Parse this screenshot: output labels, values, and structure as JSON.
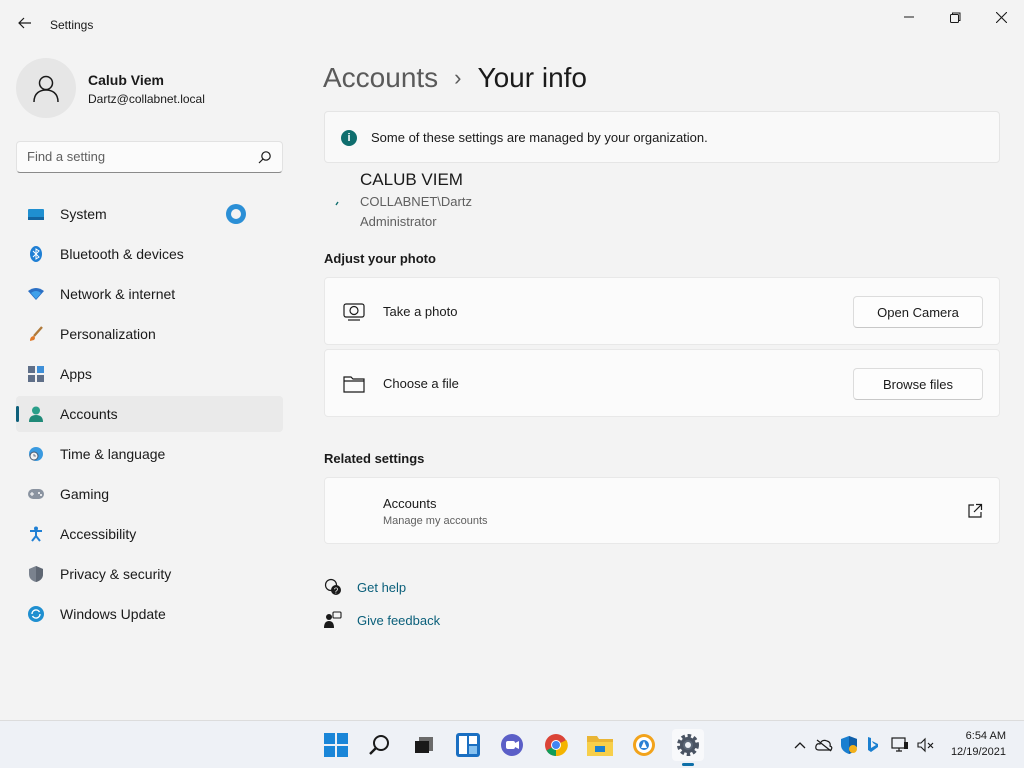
{
  "window": {
    "title": "Settings"
  },
  "profile": {
    "name": "Calub Viem",
    "email": "Dartz@collabnet.local"
  },
  "search": {
    "placeholder": "Find a setting"
  },
  "sidebar": {
    "items": [
      {
        "label": "System",
        "icon": "system-icon"
      },
      {
        "label": "Bluetooth & devices",
        "icon": "bluetooth-icon"
      },
      {
        "label": "Network & internet",
        "icon": "wifi-icon"
      },
      {
        "label": "Personalization",
        "icon": "brush-icon"
      },
      {
        "label": "Apps",
        "icon": "apps-icon"
      },
      {
        "label": "Accounts",
        "icon": "person-icon",
        "active": true
      },
      {
        "label": "Time & language",
        "icon": "clock-globe-icon"
      },
      {
        "label": "Gaming",
        "icon": "gamepad-icon"
      },
      {
        "label": "Accessibility",
        "icon": "accessibility-icon"
      },
      {
        "label": "Privacy & security",
        "icon": "shield-icon"
      },
      {
        "label": "Windows Update",
        "icon": "update-icon"
      }
    ]
  },
  "breadcrumb": {
    "parent": "Accounts",
    "separator": "›",
    "current": "Your info"
  },
  "notice": {
    "text": "Some of these settings are managed by your organization."
  },
  "account": {
    "display_name": "CALUB VIEM",
    "domain_user": "COLLABNET\\Dartz",
    "role": "Administrator"
  },
  "photo_section": {
    "title": "Adjust your photo",
    "take_photo_label": "Take a photo",
    "open_camera_label": "Open Camera",
    "choose_file_label": "Choose a file",
    "browse_files_label": "Browse files"
  },
  "related": {
    "title": "Related settings",
    "accounts_title": "Accounts",
    "accounts_subtitle": "Manage my accounts"
  },
  "help": {
    "get_help": "Get help",
    "give_feedback": "Give feedback"
  },
  "taskbar": {
    "time": "6:54 AM",
    "date": "12/19/2021"
  },
  "colors": {
    "accent": "#0e5f7a",
    "background": "#f3f3f3",
    "card": "#fbfbfb"
  }
}
